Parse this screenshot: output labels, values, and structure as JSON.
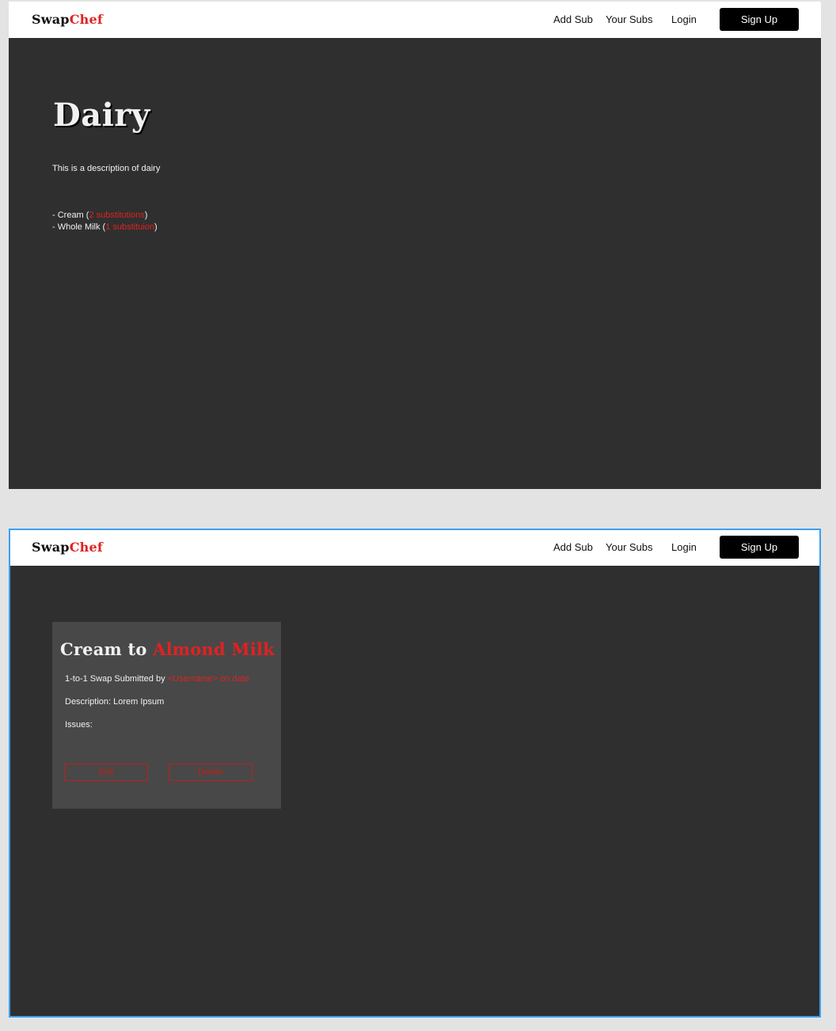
{
  "brand": {
    "part1": "Swap",
    "part2": "Chef"
  },
  "nav": {
    "add_sub": "Add Sub",
    "your_subs": "Your Subs",
    "login": "Login",
    "sign_up": "Sign Up"
  },
  "colors": {
    "accent": "#e02222",
    "dark_bg": "#2f2f2f",
    "card_bg": "#484848",
    "frame_selected_border": "#3aa0f0"
  },
  "category_page": {
    "title": "Dairy",
    "description": "This is a description of dairy",
    "items": [
      {
        "prefix": "- Cream (",
        "link": "2 substitutions",
        "suffix": ")"
      },
      {
        "prefix": "- Whole Milk (",
        "link": "1 substituion",
        "suffix": ")"
      }
    ]
  },
  "swap_page": {
    "title_from": "Cream to ",
    "title_to": "Almond Milk",
    "submitted_prefix": "1-to-1 Swap Submitted by ",
    "submitted_user": "<Username> on date",
    "description": "Description: Lorem Ipsum",
    "issues": "Issues:",
    "edit_label": "Edit",
    "delete_label": "Delete"
  }
}
